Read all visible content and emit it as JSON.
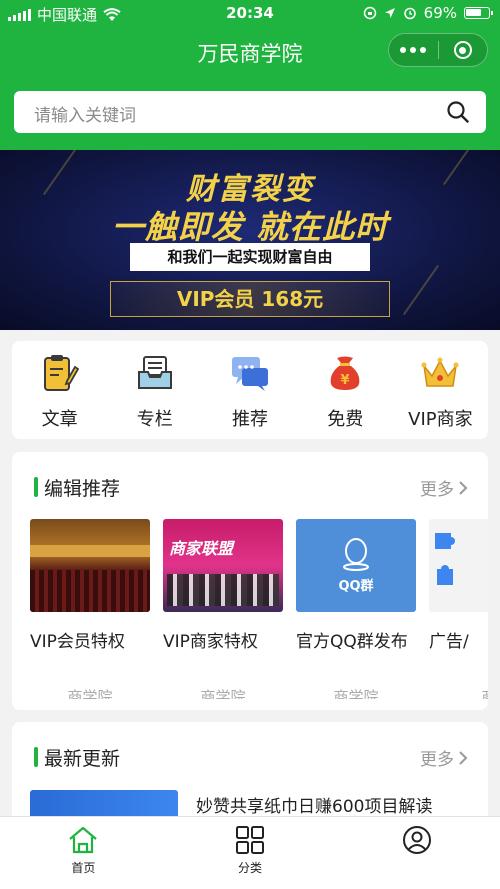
{
  "status_bar": {
    "carrier": "中国联通",
    "time": "20:34",
    "battery": "69%"
  },
  "nav": {
    "title": "万民商学院"
  },
  "search": {
    "placeholder": "请输入关键词"
  },
  "banner": {
    "line1": "财富裂变",
    "line2": "一触即发 就在此时",
    "line3": "和我们一起实现财富自由",
    "line4": "VIP会员 168元"
  },
  "categories": [
    {
      "label": "文章",
      "icon": "clipboard-pencil-icon"
    },
    {
      "label": "专栏",
      "icon": "inbox-tray-icon"
    },
    {
      "label": "推荐",
      "icon": "chat-bubbles-icon"
    },
    {
      "label": "免费",
      "icon": "money-bag-icon"
    },
    {
      "label": "VIP商家",
      "icon": "crown-icon"
    }
  ],
  "editor_picks": {
    "title": "编辑推荐",
    "more": "更多",
    "items": [
      {
        "title": "VIP会员特权",
        "source": "商学院"
      },
      {
        "title": "VIP商家特权",
        "source": "商学院",
        "image_text": "商家联盟"
      },
      {
        "title": "官方QQ群发布",
        "source": "商学院",
        "image_text": "QQ群"
      },
      {
        "title": "广告/",
        "source": "商"
      }
    ]
  },
  "latest": {
    "title": "最新更新",
    "more": "更多",
    "items": [
      {
        "title": "妙赞共享纸巾日赚600项目解读"
      }
    ]
  },
  "tabbar": {
    "tabs": [
      {
        "label": "首页",
        "icon": "home-icon",
        "active": true
      },
      {
        "label": "分类",
        "icon": "grid-icon",
        "active": false
      },
      {
        "label": "",
        "icon": "user-icon",
        "active": false
      }
    ]
  },
  "colors": {
    "brand_green": "#1fb43f",
    "banner_gold": "#f3d148"
  }
}
